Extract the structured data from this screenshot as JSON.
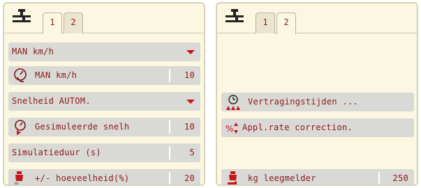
{
  "left_panel": {
    "tabs": [
      "1",
      "2"
    ],
    "active_tab": "1",
    "rows": [
      {
        "label": "MAN km/h",
        "type": "dropdown"
      },
      {
        "label": "MAN km/h",
        "value": "10",
        "icon": "speedometer-hand-icon"
      },
      {
        "label": "Snelheid AUTOM.",
        "type": "dropdown"
      },
      {
        "label": "Gesimuleerde snelh",
        "value": "10",
        "icon": "speedometer-play-icon"
      },
      {
        "label": "Simulatieduur (s)",
        "value": "5"
      },
      {
        "label": "+/- hoeveelheid(%)",
        "value": "20",
        "icon": "quantity-percent-icon"
      }
    ]
  },
  "right_panel": {
    "tabs": [
      "1",
      "2"
    ],
    "active_tab": "2",
    "rows": [
      {
        "label": "Vertragingstijden ...",
        "icon": "delay-clock-icon"
      },
      {
        "label": "Appl.rate correction.",
        "icon": "rate-correction-icon"
      },
      {
        "label": "kg leegmelder",
        "value": "250",
        "icon": "empty-alarm-icon"
      }
    ]
  },
  "colors": {
    "text": "#8b1a1a",
    "accent": "#c4161c",
    "row_bg": "#d9d9d6",
    "panel_bg": "#fbf7e0"
  }
}
